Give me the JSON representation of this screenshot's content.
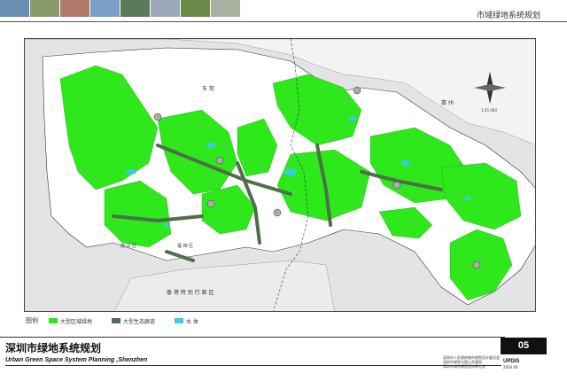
{
  "header": {
    "title": "市域绿地系统规划",
    "photos": [
      "#6a8fb0",
      "#8a9a6a",
      "#b07a6a",
      "#7aa0c8",
      "#5a7a5a",
      "#9aa8b8",
      "#6a8a4a",
      "#a8b0a0"
    ]
  },
  "map": {
    "labels": {
      "dongguan": "东 莞",
      "huizhou": "惠 州",
      "hongkong": "香 港 特 别 行 政 区",
      "nanshan": "南 山 区",
      "futian": "福 田 区"
    },
    "colors": {
      "water": "#e3e4e6",
      "land": "#ffffff",
      "green": "#2ee81c",
      "corridor": "#4f6e4a",
      "water_body": "#3ec8e8",
      "boundary": "#333333"
    },
    "compass_label": "1:55 000"
  },
  "legend": {
    "title": "图例",
    "items": [
      {
        "label": "大型区域绿地",
        "color": "#2ee81c"
      },
      {
        "label": "大型生态廊道",
        "color": "#4f6e4a"
      },
      {
        "label": "水 体",
        "color": "#3ec8e8"
      }
    ]
  },
  "footer": {
    "title_cn": "深圳市绿地系统规划",
    "title_en": "Urban Green Space System Planning ,Shenzhen",
    "sheet_number": "05",
    "credits": [
      "深圳市人民政府城市规划设计委员会",
      "深圳市规划与国土资源局",
      "深圳市城市规划设计研究院"
    ],
    "org": "UPDIS",
    "date": "2004.06"
  }
}
